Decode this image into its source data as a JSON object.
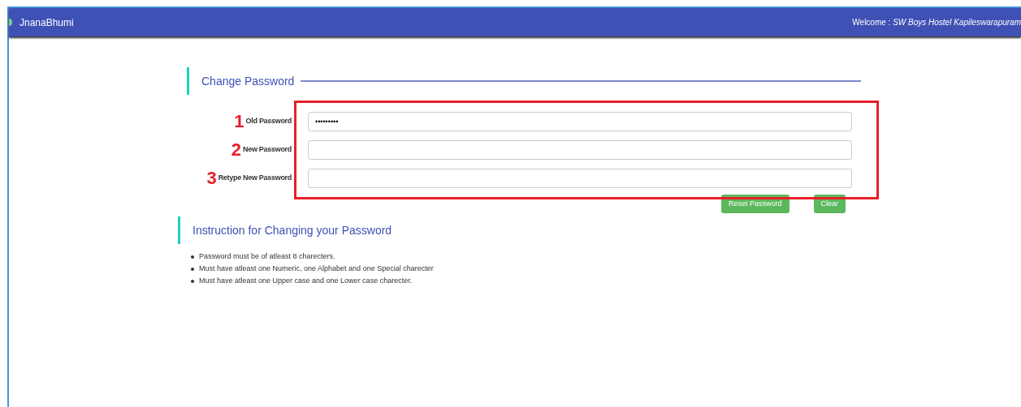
{
  "navbar": {
    "brand": "JnanaBhumi",
    "welcome_label": "Welcome :",
    "welcome_name": "SW Boys Hostel Kapileswarapuram"
  },
  "form": {
    "title": "Change Password",
    "fields": [
      {
        "label": "Old Password",
        "value": "•••••••••",
        "marker": "1"
      },
      {
        "label": "New Password",
        "marker": "2"
      },
      {
        "label": "Retype New Password",
        "marker": "3"
      }
    ],
    "buttons": [
      "Reset Password",
      "Clear"
    ]
  },
  "instructions": {
    "title": "Instruction for Changing your Password",
    "items": [
      "Password must be of atleast 8 charecters.",
      "Must have atleast one Numeric, one Alphabet and one Special charecter",
      "Must have atleast one Upper case and one Lower case charecter."
    ]
  }
}
